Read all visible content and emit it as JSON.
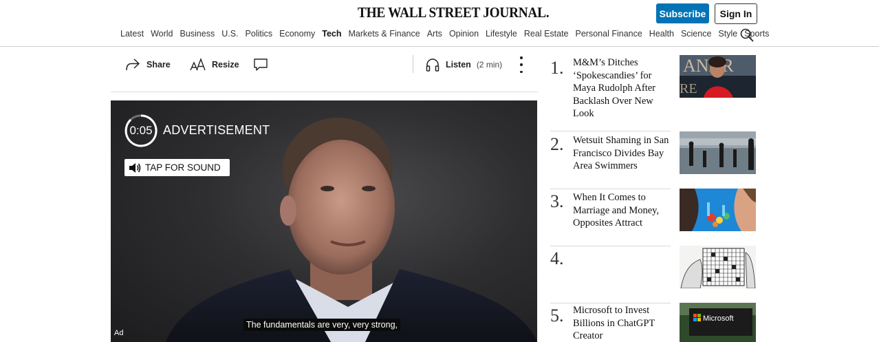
{
  "header": {
    "logo": "THE WALL STREET JOURNAL.",
    "subscribe_label": "Subscribe",
    "signin_label": "Sign In",
    "nav": [
      "Latest",
      "World",
      "Business",
      "U.S.",
      "Politics",
      "Economy",
      "Tech",
      "Markets & Finance",
      "Arts",
      "Opinion",
      "Lifestyle",
      "Real Estate",
      "Personal Finance",
      "Health",
      "Science",
      "Style",
      "Sports"
    ],
    "active_nav": "Tech",
    "accent": "#0274b6"
  },
  "toolbar": {
    "share_label": "Share",
    "resize_label": "Resize",
    "listen_label": "Listen",
    "listen_time": "(2 min)"
  },
  "video": {
    "countdown": "0:05",
    "ad_label": "ADVERTISEMENT",
    "tap_sound_label": "TAP FOR SOUND",
    "caption": "The fundamentals are very, very strong,",
    "ad_corner": "Ad"
  },
  "trending": [
    {
      "num": "1.",
      "title": "M&M’s Ditches ‘Spokescandies’ for Maya Rudolph After Backlash Over New Look"
    },
    {
      "num": "2.",
      "title": "Wetsuit Shaming in San Francisco Divides Bay Area Swimmers"
    },
    {
      "num": "3.",
      "title": "When It Comes to Marriage and Money, Opposites Attract"
    },
    {
      "num": "4.",
      "title": ""
    },
    {
      "num": "5.",
      "title": "Microsoft to Invest Billions in ChatGPT Creator"
    }
  ]
}
